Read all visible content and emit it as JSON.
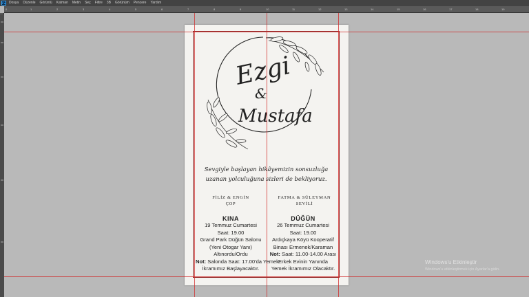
{
  "menu": {
    "logo": "Ps",
    "items": [
      "Dosya",
      "Düzenle",
      "Görüntü",
      "Katman",
      "Metin",
      "Seç",
      "Filtre",
      "3B",
      "Görünüm",
      "Pencere",
      "Yardım"
    ]
  },
  "ruler": {
    "labels": [
      "0",
      "1",
      "2",
      "3",
      "4",
      "5",
      "6",
      "7",
      "8",
      "9",
      "10",
      "11",
      "12",
      "13",
      "14",
      "15",
      "16",
      "17",
      "18",
      "19"
    ]
  },
  "invitation": {
    "bride_name": "Ezgi",
    "ampersand": "&",
    "groom_name": "Mustafa",
    "tagline_line1": "Sevgiyle başlayan hikâyemizin sonsuzluğa",
    "tagline_line2": "uzanan yolculuğuna sizleri de bekliyoruz.",
    "bride_family_line1": "FİLİZ & ENGİN",
    "bride_family_line2": "ÇOP",
    "groom_family_line1": "FATMA & SÜLEYMAN",
    "groom_family_line2": "SEVİLİ",
    "kina": {
      "title": "KINA",
      "date": "19 Temmuz Cumartesi",
      "time": "Saat: 19.00",
      "venue_line1": "Grand Park Düğün Salonu",
      "venue_line2": "(Yeni Otogar Yanı)",
      "city": "Altınordu/Ordu",
      "note_label": "Not:",
      "note_line1": " Salonda Saat: 17.00'da Yemek",
      "note_line2": "İkramımız Başlayacaktır."
    },
    "dugun": {
      "title": "DÜĞÜN",
      "date": "26 Temmuz Cumartesi",
      "time": "Saat: 19.00",
      "venue_line1": "Ardıçkaya Köyü Kooperatif",
      "venue_line2": "Binası Ermenek/Karaman",
      "note_label": "Not:",
      "note_line1": " Saat: 11.00-14.00 Arası",
      "note_line2": "Erkek Evinin Yanında",
      "note_line3": "Yemek İkramımız Olacaktır."
    }
  },
  "watermark": {
    "line1": "Windows'u Etkinleştir",
    "line2": "Windows'u etkinleştirmek için Ayarlar'a gidin."
  },
  "colors": {
    "canvas_bg": "#b9b9b9",
    "paper": "#f4f3f0",
    "guide": "#d22828",
    "margin": "#8e1f1f"
  }
}
